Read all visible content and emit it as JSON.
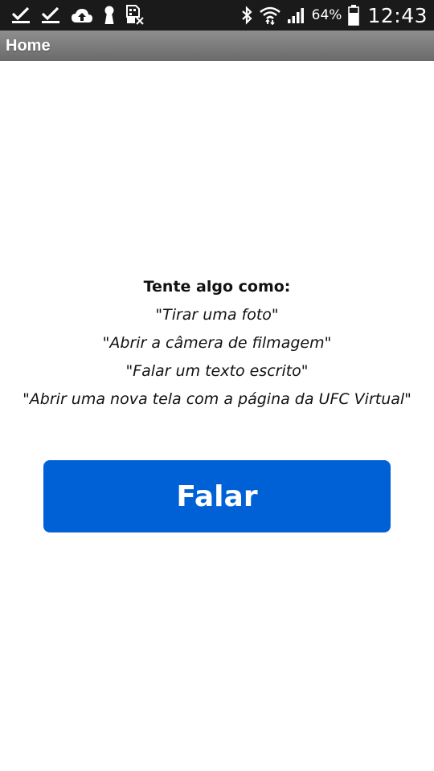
{
  "status_bar": {
    "left_icons": [
      "check-icon",
      "check-icon",
      "cloud-upload-icon",
      "keyhole-icon",
      "sim-no-signal-icon"
    ],
    "right_icons": [
      "bluetooth-icon",
      "wifi-icon",
      "cell-signal-icon",
      "battery-icon"
    ],
    "battery_percent": "64%",
    "time": "12:43"
  },
  "action_bar": {
    "title": "Home"
  },
  "main": {
    "heading": "Tente algo como:",
    "examples": [
      "\"Tirar uma foto\"",
      "\"Abrir a câmera de filmagem\"",
      "\"Falar um texto escrito\"",
      "\"Abrir uma nova tela com a página da UFC Virtual\""
    ],
    "button_label": "Falar"
  },
  "colors": {
    "status_bar_bg": "#1a1a1a",
    "action_bar_bg": "#7b7b7b",
    "button_bg": "#0060d6",
    "page_bg": "#ffffff"
  }
}
